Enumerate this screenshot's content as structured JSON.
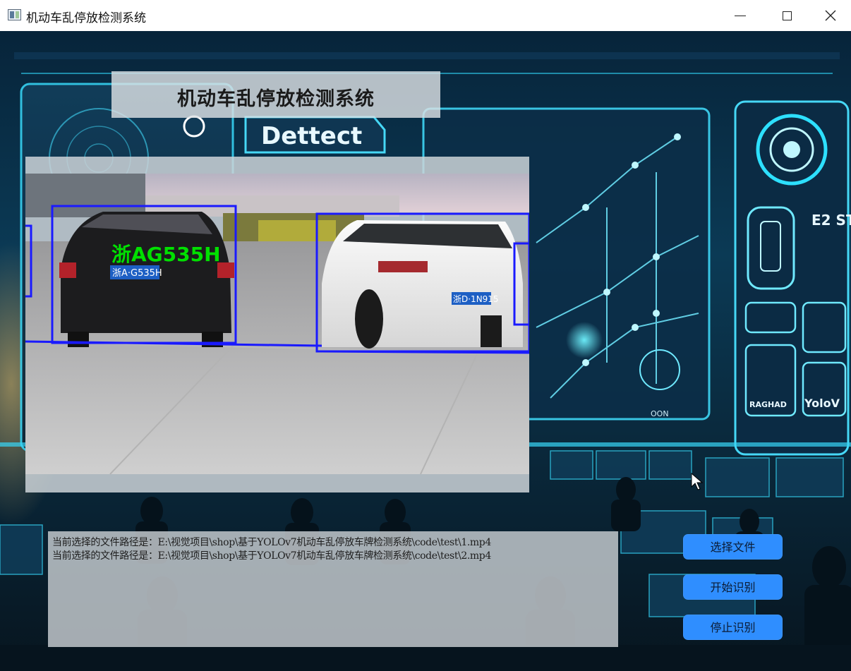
{
  "window": {
    "title": "机动车乱停放检测系统",
    "controls": [
      "minimize",
      "maximize",
      "close"
    ]
  },
  "header": {
    "title": "机动车乱停放检测系统"
  },
  "background_art": {
    "sign_text": "Dettect",
    "panel_labels": [
      "E2 ST",
      "RAGHAD",
      "YoloV",
      "OON"
    ]
  },
  "video": {
    "detections": [
      {
        "label": "浙AG535H",
        "plate_text": "浙A·G535H",
        "box_color": "#1a1aff",
        "label_color": "#00e000"
      },
      {
        "label": "",
        "plate_text": "浙D·1N915",
        "box_color": "#1a1aff"
      }
    ]
  },
  "log": {
    "lines": [
      "当前选择的文件路径是：E:\\视觉项目\\shop\\基于YOLOv7机动车乱停放车牌检测系统\\code\\test\\1.mp4",
      "当前选择的文件路径是：E:\\视觉项目\\shop\\基于YOLOv7机动车乱停放车牌检测系统\\code\\test\\2.mp4"
    ]
  },
  "buttons": {
    "select_file": "选择文件",
    "start": "开始识别",
    "stop": "停止识别"
  },
  "colors": {
    "button_bg": "#2f8eff",
    "detection_box": "#1a1aff",
    "detection_label": "#00e000",
    "accent_cyan": "#2de0ff"
  }
}
